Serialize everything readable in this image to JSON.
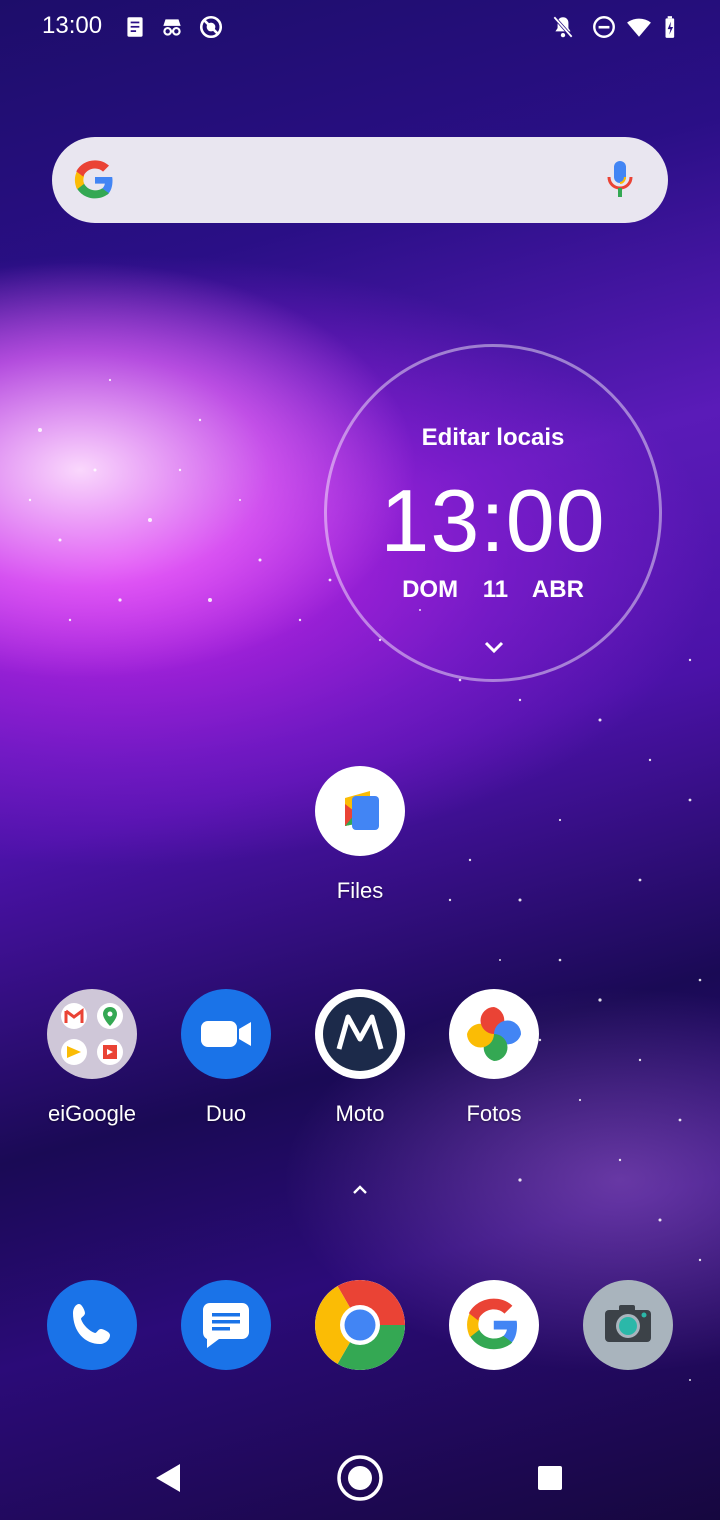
{
  "status_bar": {
    "time": "13:00",
    "left_icons": [
      "notepad-icon",
      "incognito-icon",
      "no-location-icon"
    ],
    "right_icons": [
      "notifications-off-icon",
      "do-not-disturb-icon",
      "wifi-icon",
      "battery-charging-icon"
    ]
  },
  "search_bar": {
    "placeholder": "",
    "icons": [
      "google-g-icon",
      "microphone-icon"
    ]
  },
  "clock_widget": {
    "location": "Editar locais",
    "time": "13:00",
    "date": "DOM 11 ABR"
  },
  "home_apps": [
    {
      "label": "Files",
      "icon": "files-icon"
    }
  ],
  "app_row": [
    {
      "label": "eiGoogle",
      "icon": "folder-icon"
    },
    {
      "label": "Duo",
      "icon": "duo-icon"
    },
    {
      "label": "Moto",
      "icon": "motorola-icon"
    },
    {
      "label": "Fotos",
      "icon": "photos-icon"
    }
  ],
  "dock": [
    {
      "icon": "phone-icon"
    },
    {
      "icon": "messages-icon"
    },
    {
      "icon": "chrome-icon"
    },
    {
      "icon": "google-icon"
    },
    {
      "icon": "camera-icon"
    }
  ],
  "navigation": [
    "back-icon",
    "home-icon",
    "recents-icon"
  ],
  "colors": {
    "google_blue": "#4285F4",
    "google_red": "#EA4335",
    "google_yellow": "#FBBC05",
    "google_green": "#34A853",
    "dock_blue": "#1a73e8"
  }
}
